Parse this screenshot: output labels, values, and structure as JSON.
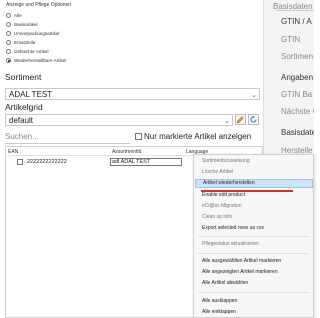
{
  "options": {
    "title": "Anzeige und Pflege Optionen",
    "radios": [
      {
        "label": "Alle",
        "checked": false
      },
      {
        "label": "Basisartikel",
        "checked": false
      },
      {
        "label": "Umverpackungsartikel",
        "checked": false
      },
      {
        "label": "Ersatzteile",
        "checked": false
      },
      {
        "label": "Gelöschte Artikel",
        "checked": false
      },
      {
        "label": "Wiederherstellbare Artikel",
        "checked": true
      }
    ]
  },
  "sortiment": {
    "label": "Sortiment",
    "value": "ADAL TEST"
  },
  "artikelgrid": {
    "label": "Artikelgrid",
    "value": "default"
  },
  "search": {
    "placeholder": "Suchen...",
    "only_marked_label": "Nur markierte Artikel anzeigen"
  },
  "grid": {
    "headers": [
      "EAN",
      "AssortmentId",
      "Language"
    ],
    "rows": [
      {
        "ean": "2222222222222",
        "assortment": "adl ADAL TEST"
      }
    ]
  },
  "right_panel": {
    "tab": "Basisdaten",
    "gtin_section": "GTIN / A",
    "gtin_label": "GTIN",
    "sortiment_label": "Sortimen",
    "angaben_section": "Angaben",
    "gtin_ba_label": "GTIN Ba",
    "naechste_label": "Nächste G",
    "basisdaten_section": "Basisdate",
    "hersteller_label": "Herstelle"
  },
  "context_menu": {
    "items": [
      {
        "label": "Sortimentszuweisung",
        "enabled": false
      },
      {
        "label": "Lösche Artikel",
        "enabled": false
      },
      {
        "label": "Artikel wiederherstellen",
        "enabled": true,
        "highlighted": true
      },
      {
        "label": "Enable edit product",
        "enabled": true
      },
      {
        "label": "eCl@ss Migration",
        "enabled": false
      },
      {
        "label": "Clean up lists",
        "enabled": false
      },
      {
        "label": "Export selected rows as csv",
        "enabled": true
      },
      {
        "label": "Pflegestatus aktualisieren",
        "enabled": false
      },
      {
        "label": "Alle ausgewählten Artikel markieren",
        "enabled": true
      },
      {
        "label": "Alle angezeigten Artikel markieren",
        "enabled": true
      },
      {
        "label": "Alle Artikel abwählen",
        "enabled": true
      },
      {
        "label": "Alle ausklappen",
        "enabled": true
      },
      {
        "label": "Alle einklappen",
        "enabled": true
      }
    ]
  },
  "colors": {
    "highlight": "#cfe3f8",
    "underline": "#c0392b",
    "accent": "#2b6cb0"
  }
}
